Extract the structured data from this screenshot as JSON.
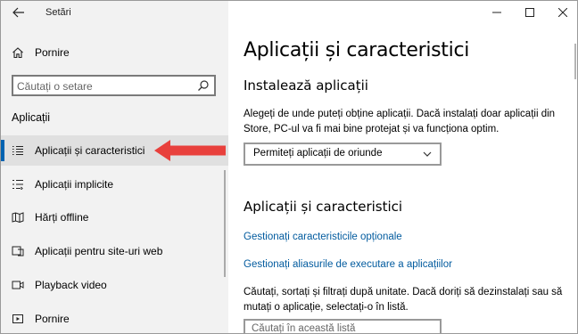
{
  "window": {
    "title": "Setări"
  },
  "sidebar": {
    "home_label": "Pornire",
    "search_placeholder": "Căutați o setare",
    "section_title": "Aplicații",
    "items": [
      {
        "label": "Aplicații și caracteristici",
        "icon": "apps-features-icon",
        "active": true
      },
      {
        "label": "Aplicații implicite",
        "icon": "default-apps-icon"
      },
      {
        "label": "Hărți offline",
        "icon": "offline-maps-icon"
      },
      {
        "label": "Aplicații pentru site-uri web",
        "icon": "apps-websites-icon"
      },
      {
        "label": "Playback video",
        "icon": "video-playback-icon"
      },
      {
        "label": "Pornire",
        "icon": "startup-icon"
      }
    ]
  },
  "content": {
    "title": "Aplicații și caracteristici",
    "install_section": {
      "title": "Instalează aplicații",
      "description": "Alegeți de unde puteți obține aplicații. Dacă instalați doar aplicații din Store, PC-ul va fi mai bine protejat și va funcționa optim.",
      "dropdown_value": "Permiteți aplicații de oriunde"
    },
    "apps_section": {
      "title": "Aplicații și caracteristici",
      "link_optional": "Gestionați caracteristicile opționale",
      "link_aliases": "Gestionați aliasurile de executare a aplicațiilor",
      "description": "Căutați, sortați și filtrați după unitate. Dacă doriți să dezinstalați sau să mutați o aplicație, selectați-o în listă.",
      "search_placeholder": "Căutați în această listă"
    }
  },
  "colors": {
    "accent": "#0063b1",
    "link": "#005a9e",
    "annotation_arrow": "#e8403c"
  }
}
